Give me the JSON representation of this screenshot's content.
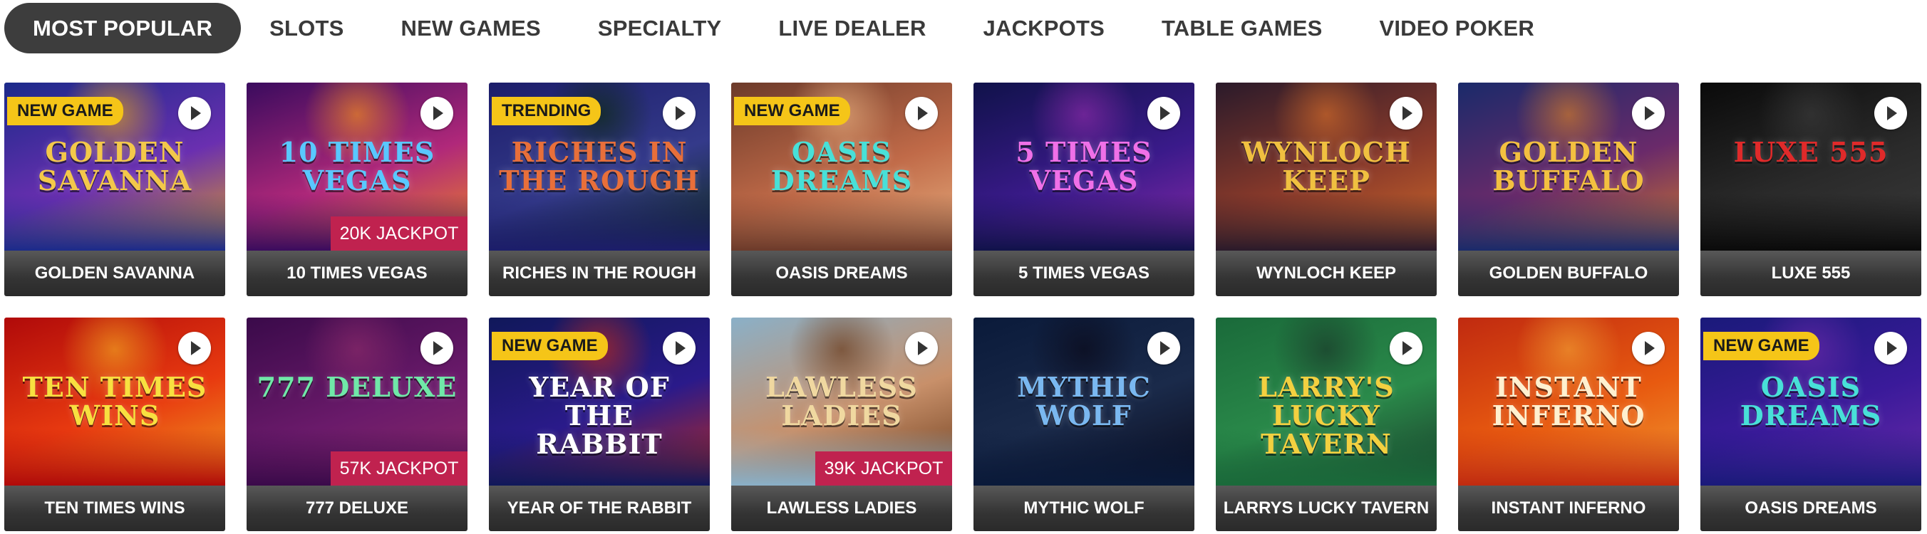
{
  "tabs": [
    {
      "label": "MOST POPULAR",
      "active": true
    },
    {
      "label": "SLOTS",
      "active": false
    },
    {
      "label": "NEW GAMES",
      "active": false
    },
    {
      "label": "SPECIALTY",
      "active": false
    },
    {
      "label": "LIVE DEALER",
      "active": false
    },
    {
      "label": "JACKPOTS",
      "active": false
    },
    {
      "label": "TABLE GAMES",
      "active": false
    },
    {
      "label": "VIDEO POKER",
      "active": false
    }
  ],
  "games": [
    {
      "name": "GOLDEN SAVANNA",
      "badge": "NEW GAME",
      "jackpot": "",
      "art_title": "GOLDEN SAVANNA",
      "bg": [
        "#1b2a8a",
        "#6a2fb0",
        "#e0a020"
      ],
      "title_color": "#f3c84a",
      "slug": "golden-savanna"
    },
    {
      "name": "10 TIMES VEGAS",
      "badge": "",
      "jackpot": "20K JACKPOT",
      "art_title": "10 TIMES VEGAS",
      "bg": [
        "#3a0b5e",
        "#b0287a",
        "#f08a20"
      ],
      "title_color": "#59c8ff",
      "slug": "10-times-vegas"
    },
    {
      "name": "RICHES IN THE ROUGH",
      "badge": "TRENDING",
      "jackpot": "",
      "art_title": "RICHES IN THE ROUGH",
      "bg": [
        "#1c1d6a",
        "#343a8a",
        "#0d2a12"
      ],
      "title_color": "#e86f3a",
      "slug": "riches-in-the-rough"
    },
    {
      "name": "OASIS DREAMS",
      "badge": "NEW GAME",
      "jackpot": "",
      "art_title": "OASIS DREAMS",
      "bg": [
        "#6c3a2a",
        "#c06a48",
        "#e8b080"
      ],
      "title_color": "#48e0d8",
      "slug": "oasis-dreams"
    },
    {
      "name": "5 TIMES VEGAS",
      "badge": "",
      "jackpot": "",
      "art_title": "5 TIMES VEGAS",
      "bg": [
        "#10124a",
        "#3a1a8a",
        "#8a2aa8"
      ],
      "title_color": "#f070e8",
      "slug": "5-times-vegas"
    },
    {
      "name": "WYNLOCH KEEP",
      "badge": "",
      "jackpot": "",
      "art_title": "WYNLOCH KEEP",
      "bg": [
        "#2a1a2a",
        "#8a3a2a",
        "#d06a2a"
      ],
      "title_color": "#f0c040",
      "slug": "wynloch-keep"
    },
    {
      "name": "GOLDEN BUFFALO",
      "badge": "",
      "jackpot": "",
      "art_title": "GOLDEN BUFFALO",
      "bg": [
        "#1a2a6a",
        "#6a2a6a",
        "#d07a2a"
      ],
      "title_color": "#f3c040",
      "slug": "golden-buffalo"
    },
    {
      "name": "LUXE 555",
      "badge": "",
      "jackpot": "",
      "art_title": "LUXE 555",
      "bg": [
        "#0a0a0a",
        "#2a2a2a",
        "#3a3a3a"
      ],
      "title_color": "#e02a2a",
      "slug": "luxe-555"
    },
    {
      "name": "TEN TIMES WINS",
      "badge": "",
      "jackpot": "",
      "art_title": "TEN TIMES WINS",
      "bg": [
        "#b00a0a",
        "#e83a10",
        "#f0a020"
      ],
      "title_color": "#f8e040",
      "slug": "ten-times-wins"
    },
    {
      "name": "777 DELUXE",
      "badge": "",
      "jackpot": "57K JACKPOT",
      "art_title": "777 DELUXE",
      "bg": [
        "#3a0a4a",
        "#6a1a6a",
        "#8a2a6a"
      ],
      "title_color": "#70e8a8",
      "slug": "777-deluxe"
    },
    {
      "name": "YEAR OF THE RABBIT",
      "badge": "NEW GAME",
      "jackpot": "",
      "art_title": "YEAR OF THE RABBIT",
      "bg": [
        "#10185a",
        "#2a1a8a",
        "#c02a1a"
      ],
      "title_color": "#ffffff",
      "slug": "year-of-the-rabbit"
    },
    {
      "name": "LAWLESS LADIES",
      "badge": "",
      "jackpot": "39K JACKPOT",
      "art_title": "LAWLESS LADIES",
      "bg": [
        "#8ab0c8",
        "#c8906a",
        "#6a3a1a"
      ],
      "title_color": "#f0d8a0",
      "slug": "lawless-ladies"
    },
    {
      "name": "MYTHIC WOLF",
      "badge": "",
      "jackpot": "",
      "art_title": "MYTHIC WOLF",
      "bg": [
        "#0a1a3a",
        "#1a2a4a",
        "#0a0a1a"
      ],
      "title_color": "#7ab8f0",
      "slug": "mythic-wolf"
    },
    {
      "name": "LARRYS LUCKY TAVERN",
      "badge": "",
      "jackpot": "",
      "art_title": "LARRY'S LUCKY TAVERN",
      "bg": [
        "#1a6a3a",
        "#2a8a4a",
        "#1a3a2a"
      ],
      "title_color": "#f3d040",
      "slug": "larrys-lucky-tavern"
    },
    {
      "name": "INSTANT INFERNO",
      "badge": "",
      "jackpot": "",
      "art_title": "INSTANT INFERNO",
      "bg": [
        "#c02a10",
        "#e85a10",
        "#f09a30"
      ],
      "title_color": "#fff0d0",
      "slug": "instant-inferno"
    },
    {
      "name": "OASIS DREAMS",
      "badge": "NEW GAME",
      "jackpot": "",
      "art_title": "OASIS DREAMS",
      "bg": [
        "#1a1a7a",
        "#3a1a9a",
        "#6a2aa8"
      ],
      "title_color": "#48e0d8",
      "slug": "oasis-dreams-2"
    }
  ],
  "icons": {
    "play": "play-icon"
  }
}
